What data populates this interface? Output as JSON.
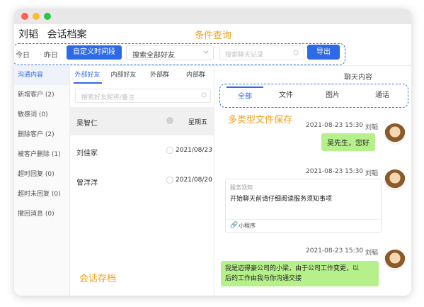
{
  "header": {
    "name": "刘韬",
    "title": "会话档案"
  },
  "features": {
    "query": "条件查询",
    "file_save": "多类型文件保存",
    "archive": "会话存档"
  },
  "filters": {
    "today": "今日",
    "yesterday": "昨日",
    "custom_range": "自定义时间段",
    "friend_select": "搜索全部好友",
    "search_placeholder": "搜索聊天记录",
    "export": "导出"
  },
  "sidebar": {
    "items": [
      {
        "label": "沟通内容"
      },
      {
        "label": "新增客户 (2)"
      },
      {
        "label": "敏感词 (0)"
      },
      {
        "label": "删除客户 (2)"
      },
      {
        "label": "被客户删除 (1)"
      },
      {
        "label": "超时回复 (0)"
      },
      {
        "label": "超时未回复 (0)"
      },
      {
        "label": "撤回消息 (0)"
      }
    ]
  },
  "friend_tabs": [
    "外部好友",
    "内部好友",
    "外部群",
    "内部群"
  ],
  "friend_search": {
    "placeholder": "搜索好友昵称/备注"
  },
  "chats": [
    {
      "name": "吴智仁",
      "time": "星期五"
    },
    {
      "name": "刘佳家",
      "time": "2021/08/23"
    },
    {
      "name": "曾洋洋",
      "time": "2021/08/20"
    }
  ],
  "chat_panel": {
    "title": "聊天内容",
    "tabs": [
      "全部",
      "文件",
      "图片",
      "通话"
    ]
  },
  "messages": [
    {
      "time": "2021-08-23 15:30",
      "sender": "刘韬",
      "text": "吴先生，您好"
    },
    {
      "time": "2021-08-23 15:30",
      "sender": "刘韬",
      "card_label": "服务须知",
      "card_title": "开始聊天前请仔细阅读服务须知事项",
      "card_footer": "小程序"
    },
    {
      "time": "2021-08-23 15:30",
      "sender": "刘韬",
      "text_line1": "我是迈得豪公司的小梁，由于公司工作变更，以",
      "text_line2": "后的工作由我与你沟通交接"
    }
  ],
  "colors": {
    "accent": "#2f6ae6",
    "feature": "#f0a020",
    "bubble": "#b6f08a"
  }
}
